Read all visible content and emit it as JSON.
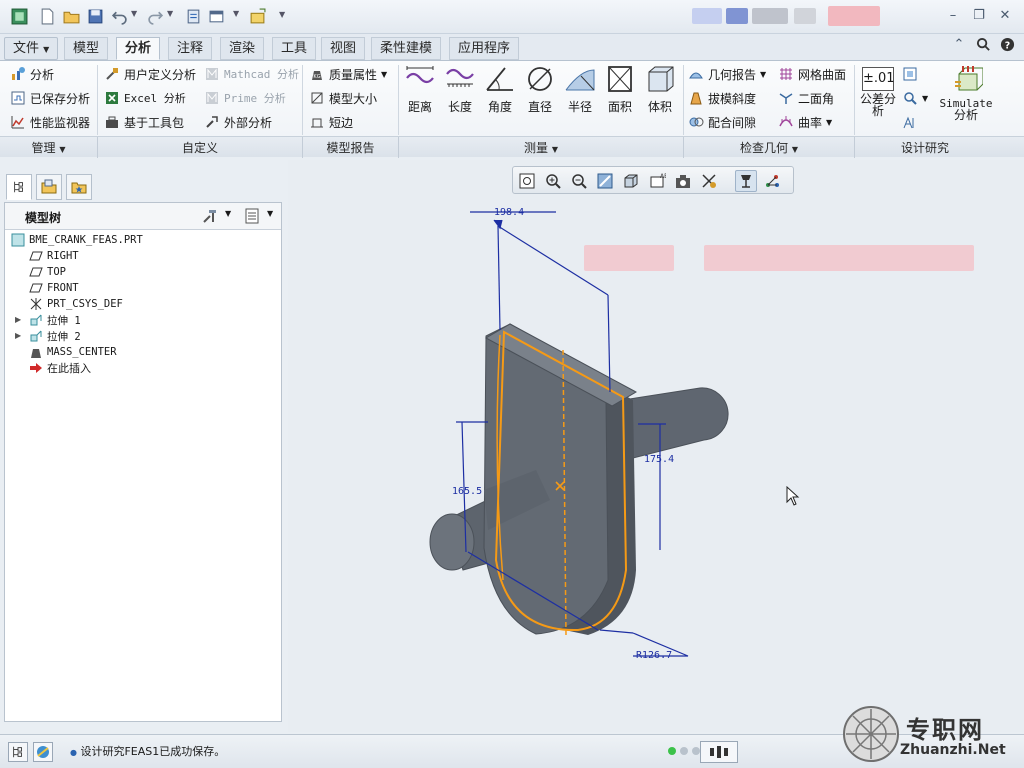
{
  "ribbon_tabs": [
    {
      "label": "文件",
      "has_dropdown": true
    },
    {
      "label": "模型"
    },
    {
      "label": "分析",
      "active": true
    },
    {
      "label": "注释"
    },
    {
      "label": "渲染"
    },
    {
      "label": "工具"
    },
    {
      "label": "视图"
    },
    {
      "label": "柔性建模"
    },
    {
      "label": "应用程序"
    }
  ],
  "ribbon": {
    "manage": {
      "analysis": "分析",
      "saved_analysis": "已保存分析",
      "perf_monitor": "性能监视器"
    },
    "custom": {
      "user_defined": "用户定义分析",
      "mathcad": "Mathcad 分析",
      "excel": "Excel 分析",
      "prime": "Prime 分析",
      "toolkit": "基于工具包",
      "external": "外部分析"
    },
    "model_report": {
      "mass_props": "质量属性",
      "model_size": "模型大小",
      "short_edge": "短边"
    },
    "measure": {
      "distance": "距离",
      "length": "长度",
      "angle": "角度",
      "diameter": "直径",
      "radius": "半径",
      "area": "面积",
      "volume": "体积"
    },
    "inspect": {
      "geom_report": "几何报告",
      "draft": "拔模斜度",
      "clearance": "配合间隙",
      "mesh_surface": "网格曲面",
      "dihedral": "二面角",
      "curvature": "曲率"
    },
    "design_study": {
      "tolerance_icon": "±.01",
      "tolerance": "公差分析",
      "simulate": "Simulate",
      "simulate_sub": "分析"
    },
    "groups": [
      "管理",
      "自定义",
      "模型报告",
      "测量",
      "检查几何",
      "设计研究"
    ]
  },
  "model_tree": {
    "title": "模型树",
    "nodes": [
      {
        "label": "BME_CRANK_FEAS.PRT",
        "icon": "part-icon",
        "level": 0
      },
      {
        "label": "RIGHT",
        "icon": "datum-plane-icon",
        "level": 1
      },
      {
        "label": "TOP",
        "icon": "datum-plane-icon",
        "level": 1
      },
      {
        "label": "FRONT",
        "icon": "datum-plane-icon",
        "level": 1
      },
      {
        "label": "PRT_CSYS_DEF",
        "icon": "csys-icon",
        "level": 1
      },
      {
        "label": "拉伸 1",
        "icon": "extrude-icon",
        "level": 1,
        "expandable": true
      },
      {
        "label": "拉伸 2",
        "icon": "extrude-icon",
        "level": 1,
        "expandable": true
      },
      {
        "label": "MASS_CENTER",
        "icon": "analysis-feature-icon",
        "level": 1
      },
      {
        "label": "在此插入",
        "icon": "insert-here-arrow-icon",
        "level": 1
      }
    ]
  },
  "dimensions": {
    "d1": "198.4",
    "d2": "175.4",
    "d3": "165.5",
    "d4": "R126.7"
  },
  "status": {
    "message": "设计研究FEAS1已成功保存。"
  },
  "watermark": {
    "text": "专职网",
    "url": "Zhuanzhi.Net"
  },
  "colors": {
    "accent_dim": "#1d2fa3",
    "highlight": "#f59a16",
    "part": "#5f6670",
    "viewport_bg": "#e8edf2"
  }
}
